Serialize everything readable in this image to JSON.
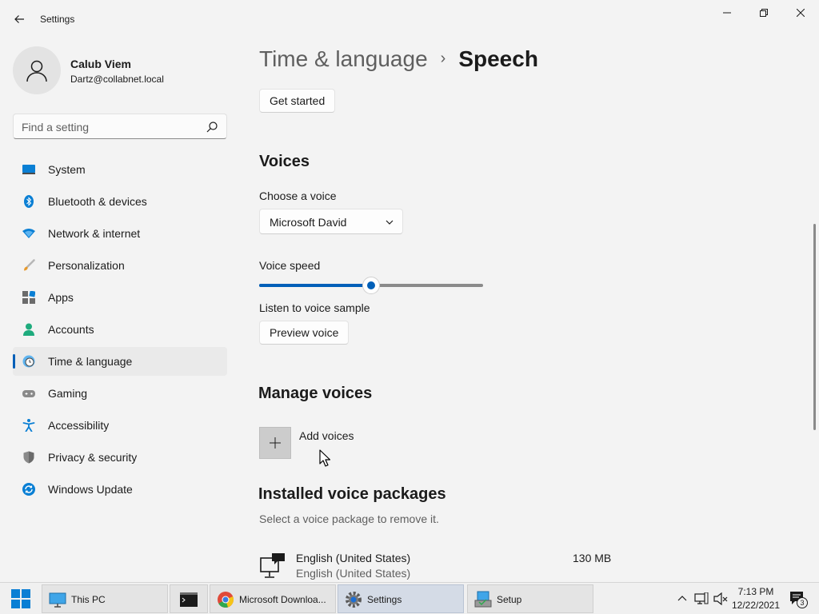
{
  "window": {
    "title": "Settings"
  },
  "profile": {
    "name": "Calub Viem",
    "email": "Dartz@collabnet.local"
  },
  "search": {
    "placeholder": "Find a setting"
  },
  "sidebar": {
    "items": [
      {
        "label": "System",
        "icon": "system-icon"
      },
      {
        "label": "Bluetooth & devices",
        "icon": "bluetooth-icon"
      },
      {
        "label": "Network & internet",
        "icon": "network-icon"
      },
      {
        "label": "Personalization",
        "icon": "brush-icon"
      },
      {
        "label": "Apps",
        "icon": "apps-icon"
      },
      {
        "label": "Accounts",
        "icon": "accounts-icon"
      },
      {
        "label": "Time & language",
        "icon": "time-language-icon",
        "active": true
      },
      {
        "label": "Gaming",
        "icon": "gamepad-icon"
      },
      {
        "label": "Accessibility",
        "icon": "accessibility-icon"
      },
      {
        "label": "Privacy & security",
        "icon": "shield-icon"
      },
      {
        "label": "Windows Update",
        "icon": "windows-update-icon"
      }
    ]
  },
  "breadcrumb": {
    "parent": "Time & language",
    "separator": "›",
    "current": "Speech"
  },
  "content": {
    "get_started_label": "Get started",
    "voices": {
      "heading": "Voices",
      "choose_label": "Choose a voice",
      "selected_voice": "Microsoft David",
      "speed_label": "Voice speed",
      "speed_value": 0.5,
      "sample_label": "Listen to voice sample",
      "preview_label": "Preview voice"
    },
    "manage": {
      "heading": "Manage voices",
      "add_label": "Add voices"
    },
    "installed": {
      "heading": "Installed voice packages",
      "description": "Select a voice package to remove it.",
      "packages": [
        {
          "name": "English (United States)",
          "subtitle": "English (United States)",
          "size": "130 MB"
        }
      ]
    }
  },
  "taskbar": {
    "items": [
      {
        "label": "This PC",
        "icon": "this-pc-icon"
      },
      {
        "label": "",
        "icon": "terminal-icon"
      },
      {
        "label": "Microsoft Downloa...",
        "icon": "chrome-icon"
      },
      {
        "label": "Settings",
        "icon": "settings-gear-icon",
        "active": true
      },
      {
        "label": "Setup",
        "icon": "setup-icon"
      }
    ],
    "clock": {
      "time": "7:13 PM",
      "date": "12/22/2021"
    },
    "notification_count": "3"
  },
  "colors": {
    "accent": "#005fb8",
    "background": "#f3f3f3",
    "taskbar": "#f0f0f0"
  }
}
